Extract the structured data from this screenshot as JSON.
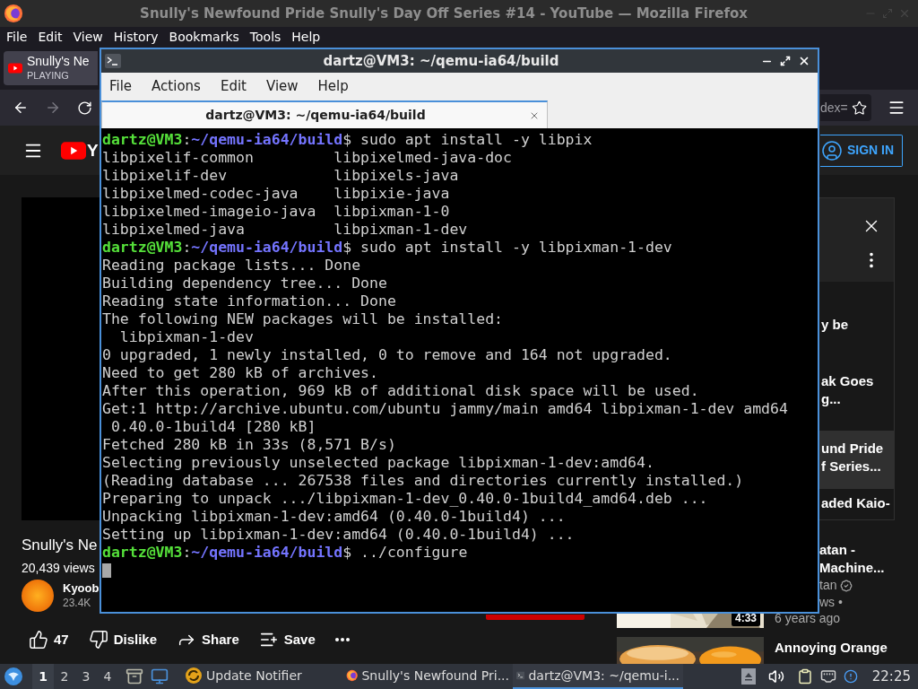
{
  "firefox": {
    "title": "Snully's Newfound Pride Snully's Day Off Series #14 - YouTube — Mozilla Firefox",
    "menu": [
      "File",
      "Edit",
      "View",
      "History",
      "Bookmarks",
      "Tools",
      "Help"
    ],
    "tab": {
      "title": "Snully's Ne",
      "status": "PLAYING",
      "selected": true
    },
    "url_fragment": "dex="
  },
  "youtube": {
    "logo_text": "Y",
    "sign_in": "SIGN IN",
    "video": {
      "title": "Snully's Ne",
      "views": "20,439 views",
      "channel": "Kyoob",
      "subscribers": "23.4K"
    },
    "actions": [
      {
        "kind": "like",
        "label": "47"
      },
      {
        "kind": "dislike",
        "label": "Dislike"
      },
      {
        "kind": "share",
        "label": "Share"
      },
      {
        "kind": "save",
        "label": "Save"
      },
      {
        "kind": "more"
      }
    ],
    "playlist": [
      {
        "lines": [
          "y be"
        ],
        "selected": false
      },
      {
        "lines": [
          "ak Goes",
          "g..."
        ],
        "selected": false
      },
      {
        "lines": [
          "und Pride",
          "f Series..."
        ],
        "selected": true
      },
      {
        "lines": [
          "aded Kaio-"
        ],
        "selected": false
      }
    ],
    "recommended": [
      {
        "title_lines": [
          "atan -",
          "Machine..."
        ],
        "channel": "tan",
        "verified": true,
        "meta": "ws •",
        "age": "6 years ago",
        "duration": "4:33"
      },
      {
        "title_lines": [
          "Annoying Orange"
        ]
      }
    ]
  },
  "terminal": {
    "title": "dartz@VM3: ~/qemu-ia64/build",
    "menu": [
      "File",
      "Actions",
      "Edit",
      "View",
      "Help"
    ],
    "tab": {
      "title": "dartz@VM3: ~/qemu-ia64/build",
      "selected": true
    },
    "lines": [
      {
        "kind": "prompt",
        "user": "dartz@VM3",
        "separator": ":",
        "path": "~/qemu-ia64/build",
        "symbol": "$",
        "command": "sudo apt install -y libpix"
      },
      {
        "kind": "columns",
        "columns": [
          "libpixelif-common",
          "libpixelmed-java-doc"
        ]
      },
      {
        "kind": "columns",
        "columns": [
          "libpixelif-dev",
          "libpixels-java"
        ]
      },
      {
        "kind": "columns",
        "columns": [
          "libpixelmed-codec-java",
          "libpixie-java"
        ]
      },
      {
        "kind": "columns",
        "columns": [
          "libpixelmed-imageio-java",
          "libpixman-1-0"
        ]
      },
      {
        "kind": "columns",
        "columns": [
          "libpixelmed-java",
          "libpixman-1-dev"
        ]
      },
      {
        "kind": "prompt",
        "user": "dartz@VM3",
        "separator": ":",
        "path": "~/qemu-ia64/build",
        "symbol": "$",
        "command": "sudo apt install -y libpixman-1-dev"
      },
      {
        "kind": "output",
        "text": "Reading package lists... Done"
      },
      {
        "kind": "output",
        "text": "Building dependency tree... Done"
      },
      {
        "kind": "output",
        "text": "Reading state information... Done"
      },
      {
        "kind": "output",
        "text": "The following NEW packages will be installed:"
      },
      {
        "kind": "output",
        "text": "  libpixman-1-dev"
      },
      {
        "kind": "output",
        "text": "0 upgraded, 1 newly installed, 0 to remove and 164 not upgraded."
      },
      {
        "kind": "output",
        "text": "Need to get 280 kB of archives."
      },
      {
        "kind": "output",
        "text": "After this operation, 969 kB of additional disk space will be used."
      },
      {
        "kind": "output",
        "text": "Get:1 http://archive.ubuntu.com/ubuntu jammy/main amd64 libpixman-1-dev amd64"
      },
      {
        "kind": "output",
        "text": " 0.40.0-1build4 [280 kB]"
      },
      {
        "kind": "output",
        "text": "Fetched 280 kB in 33s (8,571 B/s)"
      },
      {
        "kind": "output",
        "text": "Selecting previously unselected package libpixman-1-dev:amd64."
      },
      {
        "kind": "output",
        "text": "(Reading database ... 267538 files and directories currently installed.)"
      },
      {
        "kind": "output",
        "text": "Preparing to unpack .../libpixman-1-dev_0.40.0-1build4_amd64.deb ..."
      },
      {
        "kind": "output",
        "text": "Unpacking libpixman-1-dev:amd64 (0.40.0-1build4) ..."
      },
      {
        "kind": "output",
        "text": "Setting up libpixman-1-dev:amd64 (0.40.0-1build4) ..."
      },
      {
        "kind": "prompt",
        "user": "dartz@VM3",
        "separator": ":",
        "path": "~/qemu-ia64/build",
        "symbol": "$",
        "command": "../configure"
      },
      {
        "kind": "cursor"
      }
    ]
  },
  "taskbar": {
    "workspaces": [
      {
        "label": "1",
        "selected": true
      },
      {
        "label": "2",
        "selected": false
      },
      {
        "label": "3",
        "selected": false
      },
      {
        "label": "4",
        "selected": false
      }
    ],
    "tasks": [
      {
        "kind": "updater",
        "label": "Update Notifier",
        "selected": false
      },
      {
        "kind": "browser",
        "label": "Snully's Newfound Pri...",
        "selected": false
      },
      {
        "kind": "terminal",
        "label": "dartz@VM3: ~/qemu-i...",
        "selected": true
      }
    ],
    "clock": "22:25"
  }
}
